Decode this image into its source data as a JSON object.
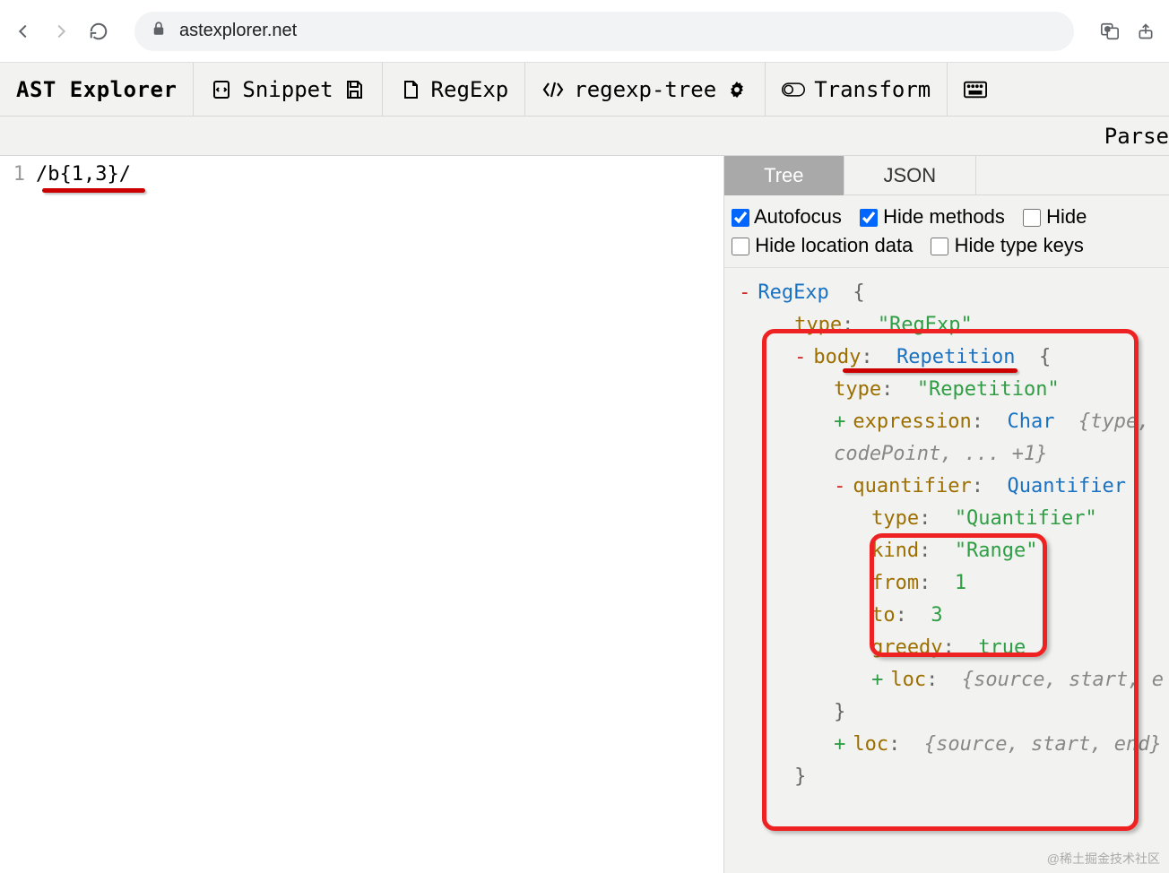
{
  "browser": {
    "url": "astexplorer.net"
  },
  "toolbar": {
    "appname": "AST Explorer",
    "snippet": "Snippet",
    "lang": "RegExp",
    "parser": "regexp-tree",
    "transform": "Transform"
  },
  "subbar": {
    "parser_label": "Parse"
  },
  "editor": {
    "line_no": "1",
    "code": "/b{1,3}/"
  },
  "tabs": {
    "tree": "Tree",
    "json": "JSON"
  },
  "options": {
    "autofocus": "Autofocus",
    "hide_methods": "Hide methods",
    "hide_empty": "Hide",
    "hide_loc": "Hide location data",
    "hide_type": "Hide type keys"
  },
  "ast": {
    "root_type": "RegExp",
    "root_brace": "{",
    "type_key": "type",
    "type_val": "\"RegExp\"",
    "body_key": "body",
    "body_type": "Repetition",
    "body_brace": "{",
    "rep_type_key": "type",
    "rep_type_val": "\"Repetition\"",
    "expr_key": "expression",
    "expr_type": "Char",
    "expr_fold": "{type,",
    "expr_fold2": "codePoint, ... +1}",
    "quant_key": "quantifier",
    "quant_type": "Quantifier",
    "quant_type_key": "type",
    "quant_type_val": "\"Quantifier\"",
    "kind_key": "kind",
    "kind_val": "\"Range\"",
    "from_key": "from",
    "from_val": "1",
    "to_key": "to",
    "to_val": "3",
    "greedy_key": "greedy",
    "greedy_val": "true",
    "loc_key": "loc",
    "loc_fold": "{source, start, e",
    "close1": "}",
    "loc2_key": "loc",
    "loc2_fold": "{source, start, end}",
    "close2": "}"
  },
  "watermark": "@稀土掘金技术社区"
}
